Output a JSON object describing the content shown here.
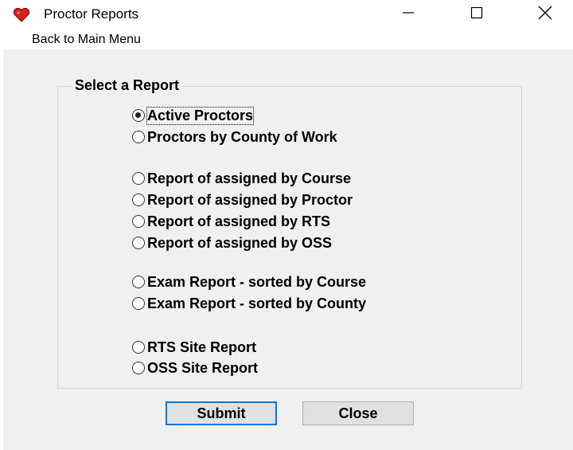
{
  "window": {
    "title": "Proctor Reports",
    "icon": "heart-icon",
    "controls": {
      "minimize": "minimize-icon",
      "maximize": "maximize-icon",
      "close": "close-icon"
    }
  },
  "menu": {
    "back": "Back to Main Menu"
  },
  "group": {
    "label": "Select a Report",
    "options": [
      {
        "label": "Active Proctors",
        "checked": true
      },
      {
        "label": "Proctors by County of Work",
        "checked": false
      },
      {
        "label": "Report of assigned by Course",
        "checked": false
      },
      {
        "label": "Report of assigned by Proctor",
        "checked": false
      },
      {
        "label": "Report of assigned by RTS",
        "checked": false
      },
      {
        "label": "Report of assigned by OSS",
        "checked": false
      },
      {
        "label": "Exam Report - sorted by Course",
        "checked": false
      },
      {
        "label": "Exam Report - sorted by County",
        "checked": false
      },
      {
        "label": "RTS Site Report",
        "checked": false
      },
      {
        "label": "OSS Site Report",
        "checked": false
      }
    ]
  },
  "buttons": {
    "submit": "Submit",
    "close": "Close"
  },
  "colors": {
    "icon_red": "#d42020",
    "default_button_border": "#0078d7",
    "client_bg": "#f0f0f0"
  }
}
